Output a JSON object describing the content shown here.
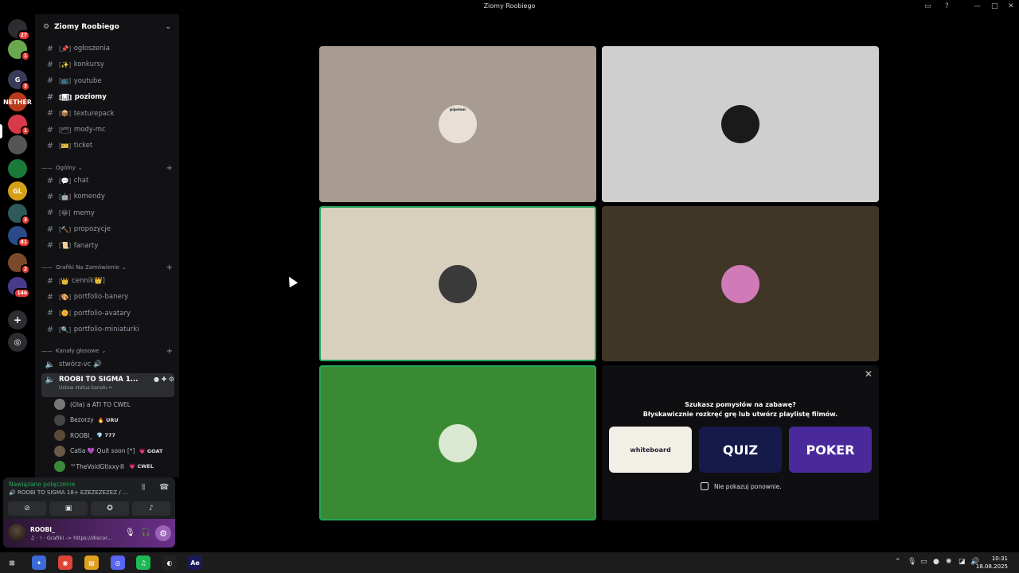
{
  "window": {
    "title": "Ziomy Roobiego"
  },
  "guilds": [
    {
      "label": "",
      "badge": "27",
      "color": "#2b2d31"
    },
    {
      "label": "",
      "badge": "1",
      "color": "#6aa84f"
    },
    {
      "label": "G",
      "badge": "3",
      "color": "#3a3a5a"
    },
    {
      "label": "NETHER",
      "badge": "",
      "color": "#b83a1a"
    },
    {
      "label": "",
      "badge": "1",
      "color": "#d93a4a"
    },
    {
      "label": "",
      "badge": "",
      "color": "#555"
    },
    {
      "label": "",
      "badge": "",
      "color": "#1a7a3a"
    },
    {
      "label": "GL",
      "badge": "",
      "color": "#d4a017"
    },
    {
      "label": "",
      "badge": "3",
      "color": "#2f5a5a"
    },
    {
      "label": "",
      "badge": "81",
      "color": "#2a4a8a"
    },
    {
      "label": "",
      "badge": "2",
      "color": "#7a4a2a"
    },
    {
      "label": "",
      "badge": "146",
      "color": "#4a3a8a"
    }
  ],
  "server": {
    "name": "Ziomy Roobiego"
  },
  "channels_top": [
    {
      "emoji": "[📌]",
      "label": "ogłoszenia"
    },
    {
      "emoji": "[✨]",
      "label": "konkursy"
    },
    {
      "emoji": "[📺]",
      "label": "youtube"
    },
    {
      "emoji": "[📊]",
      "label": "poziomy",
      "active": true
    },
    {
      "emoji": "[📦]",
      "label": "texturepack"
    },
    {
      "emoji": "[🗂]",
      "label": "mody-mc"
    },
    {
      "emoji": "[🎫]",
      "label": "ticket"
    }
  ],
  "category_general": "Ogólny",
  "channels_general": [
    {
      "emoji": "[💬]",
      "label": "chat"
    },
    {
      "emoji": "[🤖]",
      "label": "komendy"
    },
    {
      "emoji": "[😂]",
      "label": "memy"
    },
    {
      "emoji": "[🔨]",
      "label": "propozycje"
    },
    {
      "emoji": "[📜]",
      "label": "fanarty"
    }
  ],
  "category_graphics": "Grafiki Na Zamówienie",
  "channels_graphics": [
    {
      "emoji": "[👑",
      "label": "cennik👑]"
    },
    {
      "emoji": "[🎨]",
      "label": "portfolio-banery"
    },
    {
      "emoji": "[🌼]",
      "label": "portfolio-avatary"
    },
    {
      "emoji": "[🔍]",
      "label": "portfolio-miniaturki"
    }
  ],
  "category_voice": "Kanały głosowe",
  "voice_channels": [
    {
      "label": "stwórz-vc 🔊"
    },
    {
      "label": "ROOBI TO SIGMA 1...",
      "status": "Ustaw status kanału ✏"
    }
  ],
  "voice_members": [
    {
      "name": "(Ola) a ATI TO CWEL",
      "tag": "",
      "color": "#777"
    },
    {
      "name": "Bezorzy",
      "tag": "🔥 URU",
      "color": "#444"
    },
    {
      "name": "ROOBI_",
      "tag": "💎 777",
      "color": "#5a4a3a"
    },
    {
      "name": "Catia 💜 Quit soon [*]",
      "tag": "💗 GOAT",
      "color": "#6a5a4a"
    },
    {
      "name": "™TheVoidGtlxxy®",
      "tag": "💗 CWEL",
      "color": "#3a8a3a"
    }
  ],
  "voice_panel": {
    "status": "Nawiązano połączenie",
    "channel": "🔊 ROOBI TO SIGMA 18+ EZEZEZEZEZ / ..."
  },
  "user_panel": {
    "name": "ROOBI_",
    "subtitle": "♫ · ! · Grafiki -> https://discor..."
  },
  "tiles": [
    {
      "bg": "#a89c92",
      "avatar_bg": "#e8e0d8",
      "label": "pipolsm",
      "speaking": false
    },
    {
      "bg": "#cfcfcf",
      "avatar_bg": "#1a1a1a",
      "label": "",
      "speaking": false
    },
    {
      "bg": "#d8d0bc",
      "avatar_bg": "#3a3a3a",
      "label": "",
      "speaking": true
    },
    {
      "bg": "#3f3628",
      "avatar_bg": "#d17ab8",
      "label": "",
      "speaking": false
    },
    {
      "bg": "#3a8a33",
      "avatar_bg": "#d9e8d0",
      "label": "",
      "speaking": true
    }
  ],
  "activity": {
    "title1": "Szukasz pomysłów na zabawę?",
    "title2": "Błyskawicznie rozkręć grę lub utwórz playlistę filmów.",
    "cards": [
      {
        "label": "whiteboard",
        "bg": "#f2efe6",
        "fg": "#223"
      },
      {
        "label": "QUIZ",
        "bg": "#161a4a",
        "fg": "#fff"
      },
      {
        "label": "POKER",
        "bg": "#4a2a9a",
        "fg": "#fff"
      }
    ],
    "checkbox_label": "Nie pokazuj ponownie."
  },
  "taskbar": {
    "apps": [
      "⊞",
      "✦",
      "◉",
      "▤",
      "◎",
      "♫",
      "◐",
      "Ae"
    ],
    "time": "10:31",
    "date": "18.08.2025"
  }
}
